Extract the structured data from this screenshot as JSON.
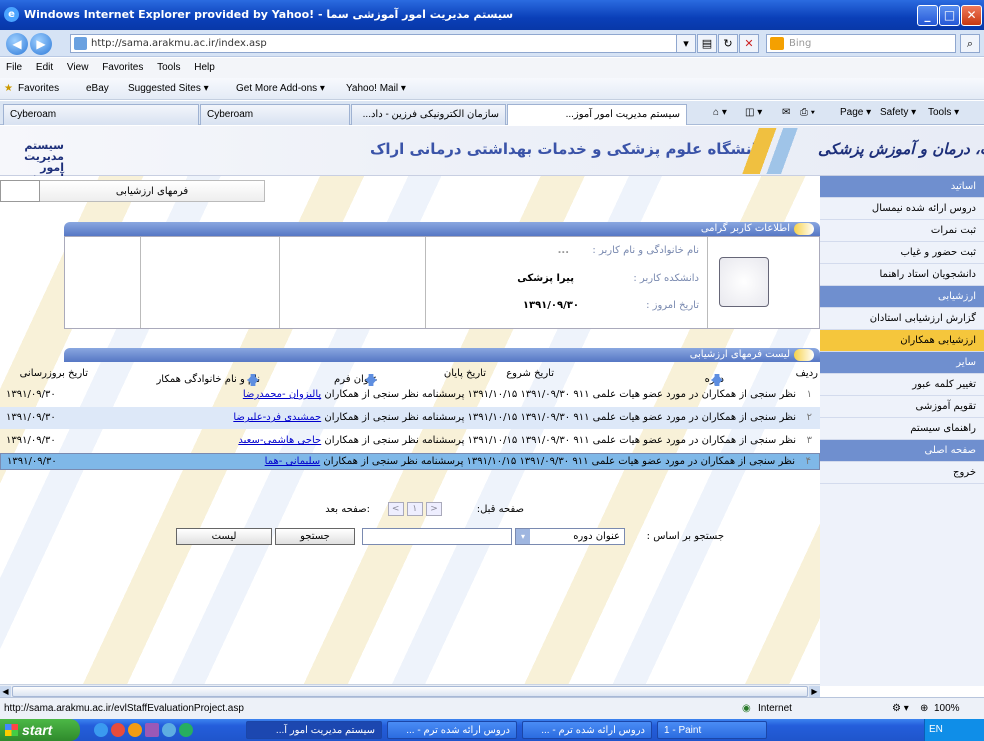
{
  "window": {
    "title": "Windows Internet Explorer provided by Yahoo! - سیستم مدیریت امور آموزشی سما",
    "min": "_",
    "max": "□",
    "close": "✕"
  },
  "address": {
    "url": "http://sama.arakmu.ac.ir/index.asp",
    "search_placeholder": "Bing"
  },
  "menu": [
    "File",
    "Edit",
    "View",
    "Favorites",
    "Tools",
    "Help"
  ],
  "favorites": {
    "label": "Favorites",
    "items": [
      "eBay",
      "Suggested Sites ▾",
      "Get More Add-ons ▾",
      "Yahoo! Mail ▾"
    ]
  },
  "tabs": [
    "Cyberoam",
    "Cyberoam",
    "سازمان الکترونیکی فرزین - داد...",
    "سیستم مدیریت امور آموز...",
    "x"
  ],
  "commands": {
    "page": "Page ▾",
    "safety": "Safety ▾",
    "tools": "Tools ▾"
  },
  "banner": {
    "university": "دانشگاه علوم پزشکی و خدمات بهداشتی درمانی اراک",
    "system": "سیستم مدیریت امور آموزشی سما",
    "ministry": "وزارت بهداشت، درمان و آموزش پزشکی"
  },
  "sidebar": {
    "items": [
      {
        "label": "اساتید",
        "kind": "head"
      },
      {
        "label": "دروس ارائه شده نیمسال",
        "kind": "item"
      },
      {
        "label": "ثبت نمرات",
        "kind": "item"
      },
      {
        "label": "ثبت حضور و غیاب",
        "kind": "item"
      },
      {
        "label": "دانشجویان استاد راهنما",
        "kind": "item"
      },
      {
        "label": "ارزشیابی",
        "kind": "head"
      },
      {
        "label": "گزارش ارزشیابی استادان",
        "kind": "item"
      },
      {
        "label": "ارزشیابی همکاران",
        "kind": "hl"
      },
      {
        "label": "سایر",
        "kind": "head"
      },
      {
        "label": "تغییر کلمه عبور",
        "kind": "item"
      },
      {
        "label": "تقویم آموزشی",
        "kind": "item"
      },
      {
        "label": "راهنمای سیستم",
        "kind": "item"
      },
      {
        "label": "صفحه اصلی",
        "kind": "head"
      },
      {
        "label": "خروج",
        "kind": "item"
      }
    ]
  },
  "form_tab": "فرمهای ارزشیابی",
  "user_info": {
    "header": "اطلاعات کاربر گرامی",
    "name_label": "نام خانوادگی و نام کاربر :",
    "name_value": "...",
    "faculty_label": "دانشکده کاربر :",
    "faculty_value": "پیرا پزشکی",
    "date_label": "تاریخ امروز :",
    "date_value": "۱۳۹۱/۰۹/۳۰"
  },
  "list": {
    "header": "لیست فرمهای ارزشیابی",
    "columns": {
      "row": "ردیف",
      "term": "دوره",
      "start": "تاریخ شروع",
      "end": "تاریخ پایان",
      "form_title": "عنوان فرم",
      "colleague": "نام و نام خانوادگی همکار",
      "updated": "تاریخ بروزرسانی"
    },
    "rows": [
      {
        "n": "۱",
        "text": "نظر سنجی از همکاران در مورد عضو هیات علمی ۹۱۱ ۱۳۹۱/۰۹/۳۰ ۱۳۹۱/۱۰/۱۵ پرسشنامه نظر سنجی از همکاران",
        "link": "پالیزوان -محمدرضا",
        "date": "۱۳۹۱/۰۹/۳۰"
      },
      {
        "n": "۲",
        "text": "نظر سنجی از همکاران در مورد عضو هیات علمی ۹۱۱ ۱۳۹۱/۰۹/۳۰ ۱۳۹۱/۱۰/۱۵ پرسشنامه نظر سنجی از همکاران",
        "link": "جمشیدی فرد-علیرضا",
        "date": "۱۳۹۱/۰۹/۳۰"
      },
      {
        "n": "۳",
        "text": "نظر سنجی از همکاران در مورد عضو هیات علمی ۹۱۱ ۱۳۹۱/۰۹/۳۰ ۱۳۹۱/۱۰/۱۵ پرسشنامه نظر سنجی از همکاران",
        "link": "حاجی هاشمی-سعید",
        "date": "۱۳۹۱/۰۹/۳۰"
      },
      {
        "n": "۴",
        "text": "نظر سنجی از همکاران در مورد عضو هیات علمی ۹۱۱ ۱۳۹۱/۰۹/۳۰ ۱۳۹۱/۱۰/۱۵ پرسشنامه نظر سنجی از همکاران",
        "link": "سلیمانی -هما",
        "date": "۱۳۹۱/۰۹/۳۰"
      }
    ]
  },
  "pager": {
    "prev": "صفحه قبل:",
    "next": ":صفحه بعد",
    "page": "۱"
  },
  "search": {
    "label": "جستجو بر اساس :",
    "field": "عنوان دوره",
    "search_btn": "جستجو",
    "list_btn": "لیست"
  },
  "status": {
    "url": "http://sama.arakmu.ac.ir/evlStaffEvaluationProject.asp",
    "zone": "Internet",
    "zoom": "100%"
  },
  "taskbar": {
    "start": "start",
    "tasks": [
      "سیستم مدیریت امور آ...",
      "دروس ارائه شده ترم - ...",
      "دروس ارائه شده ترم - ...",
      "1 - Paint"
    ],
    "lang": "EN"
  },
  "colors": {
    "accent": "#5677c4",
    "highlight": "#f5c63c",
    "title_blue": "#3a53a8"
  }
}
